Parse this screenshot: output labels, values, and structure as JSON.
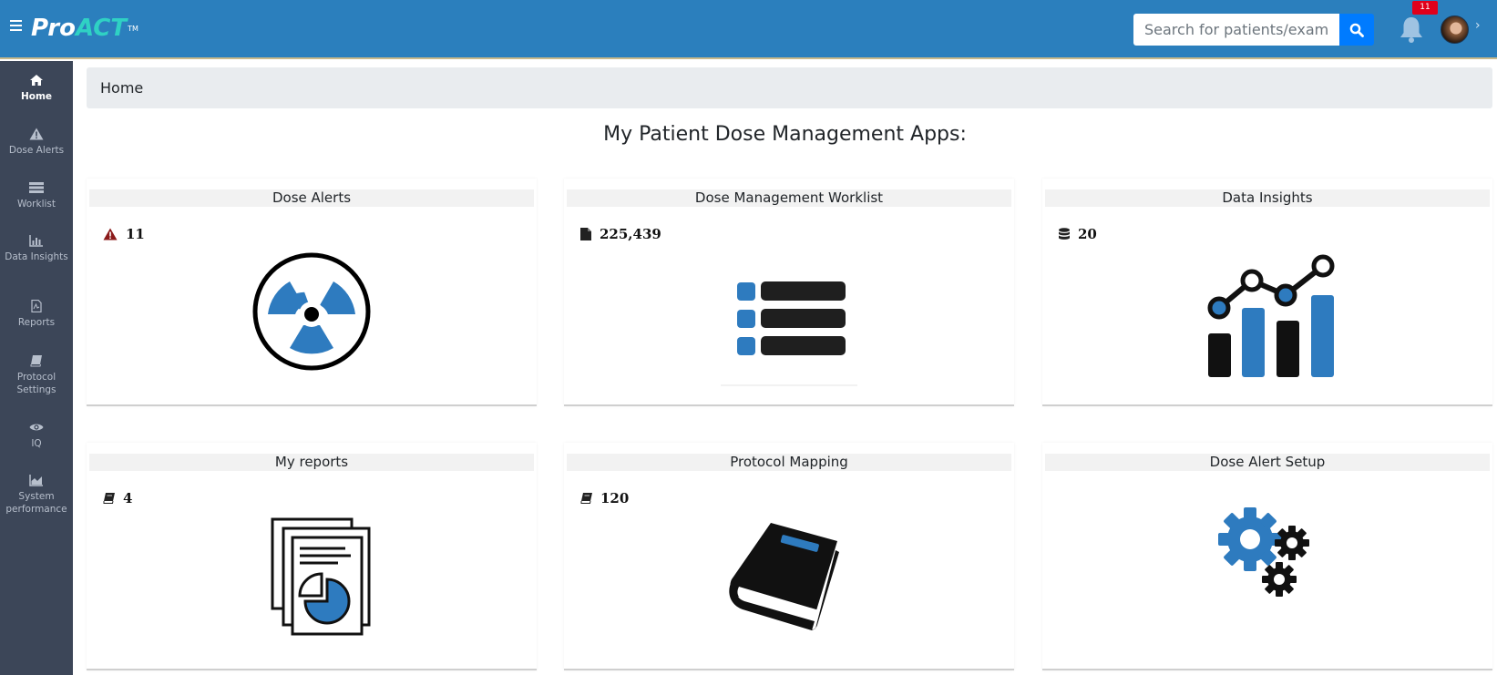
{
  "header": {
    "logo_main": "Pro",
    "logo_accent": "ACT",
    "logo_tm": "TM",
    "search_placeholder": "Search for patients/exams",
    "notification_count": "11"
  },
  "sidebar": {
    "items": [
      {
        "label": "Home",
        "icon": "home-icon",
        "active": true
      },
      {
        "label": "Dose Alerts",
        "icon": "warning-icon"
      },
      {
        "label": "Worklist",
        "icon": "list-icon"
      },
      {
        "label": "Data Insights",
        "icon": "bar-chart-icon"
      },
      {
        "label": "Reports",
        "icon": "pdf-file-icon"
      },
      {
        "label": "Protocol Settings",
        "icon": "book-icon"
      },
      {
        "label": "IQ",
        "icon": "eye-icon"
      },
      {
        "label": "System performance",
        "icon": "area-chart-icon"
      }
    ]
  },
  "breadcrumb": "Home",
  "page_title": "My Patient Dose Management Apps:",
  "cards": [
    {
      "title": "Dose Alerts",
      "count": "11",
      "stat_icon": "warning-icon",
      "image": "radiation-icon",
      "stat_color": "#8b1a1a"
    },
    {
      "title": "Dose Management Worklist",
      "count": "225,439",
      "stat_icon": "file-icon",
      "image": "worklist-icon"
    },
    {
      "title": "Data Insights",
      "count": "20",
      "stat_icon": "database-icon",
      "image": "insights-chart-icon"
    },
    {
      "title": "My reports",
      "count": "4",
      "stat_icon": "book-icon",
      "image": "reports-icon"
    },
    {
      "title": "Protocol Mapping",
      "count": "120",
      "stat_icon": "book-icon",
      "image": "protocol-book-icon"
    },
    {
      "title": "Dose Alert Setup",
      "count": "",
      "stat_icon": "",
      "image": "gears-icon"
    }
  ],
  "colors": {
    "topbar": "#2b7fbd",
    "sidebar": "#3c4658",
    "accent_blue": "#2e7bbf",
    "search_button": "#007bff",
    "badge": "#e0001b"
  }
}
